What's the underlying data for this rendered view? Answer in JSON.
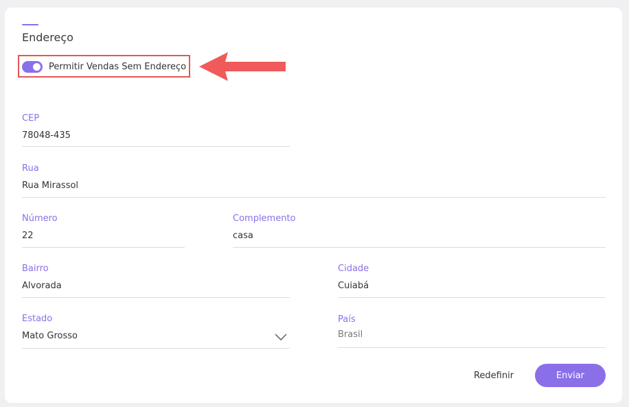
{
  "section": {
    "title": "Endereço"
  },
  "toggle": {
    "label": "Permitir Vendas Sem Endereço",
    "checked": true
  },
  "annotation": {
    "highlight_color": "#e25555",
    "arrow_color": "#f05a5a"
  },
  "fields": {
    "cep": {
      "label": "CEP",
      "value": "78048-435"
    },
    "rua": {
      "label": "Rua",
      "value": "Rua Mirassol"
    },
    "numero": {
      "label": "Número",
      "value": "22"
    },
    "complemento": {
      "label": "Complemento",
      "value": "casa"
    },
    "bairro": {
      "label": "Bairro",
      "value": "Alvorada"
    },
    "cidade": {
      "label": "Cidade",
      "value": "Cuiabá"
    },
    "estado": {
      "label": "Estado",
      "value": "Mato Grosso"
    },
    "pais": {
      "label": "País",
      "value": "Brasil"
    }
  },
  "actions": {
    "reset_label": "Redefinir",
    "submit_label": "Enviar"
  },
  "colors": {
    "accent": "#8b6fe8",
    "background": "#f0f0f2",
    "card": "#ffffff"
  }
}
